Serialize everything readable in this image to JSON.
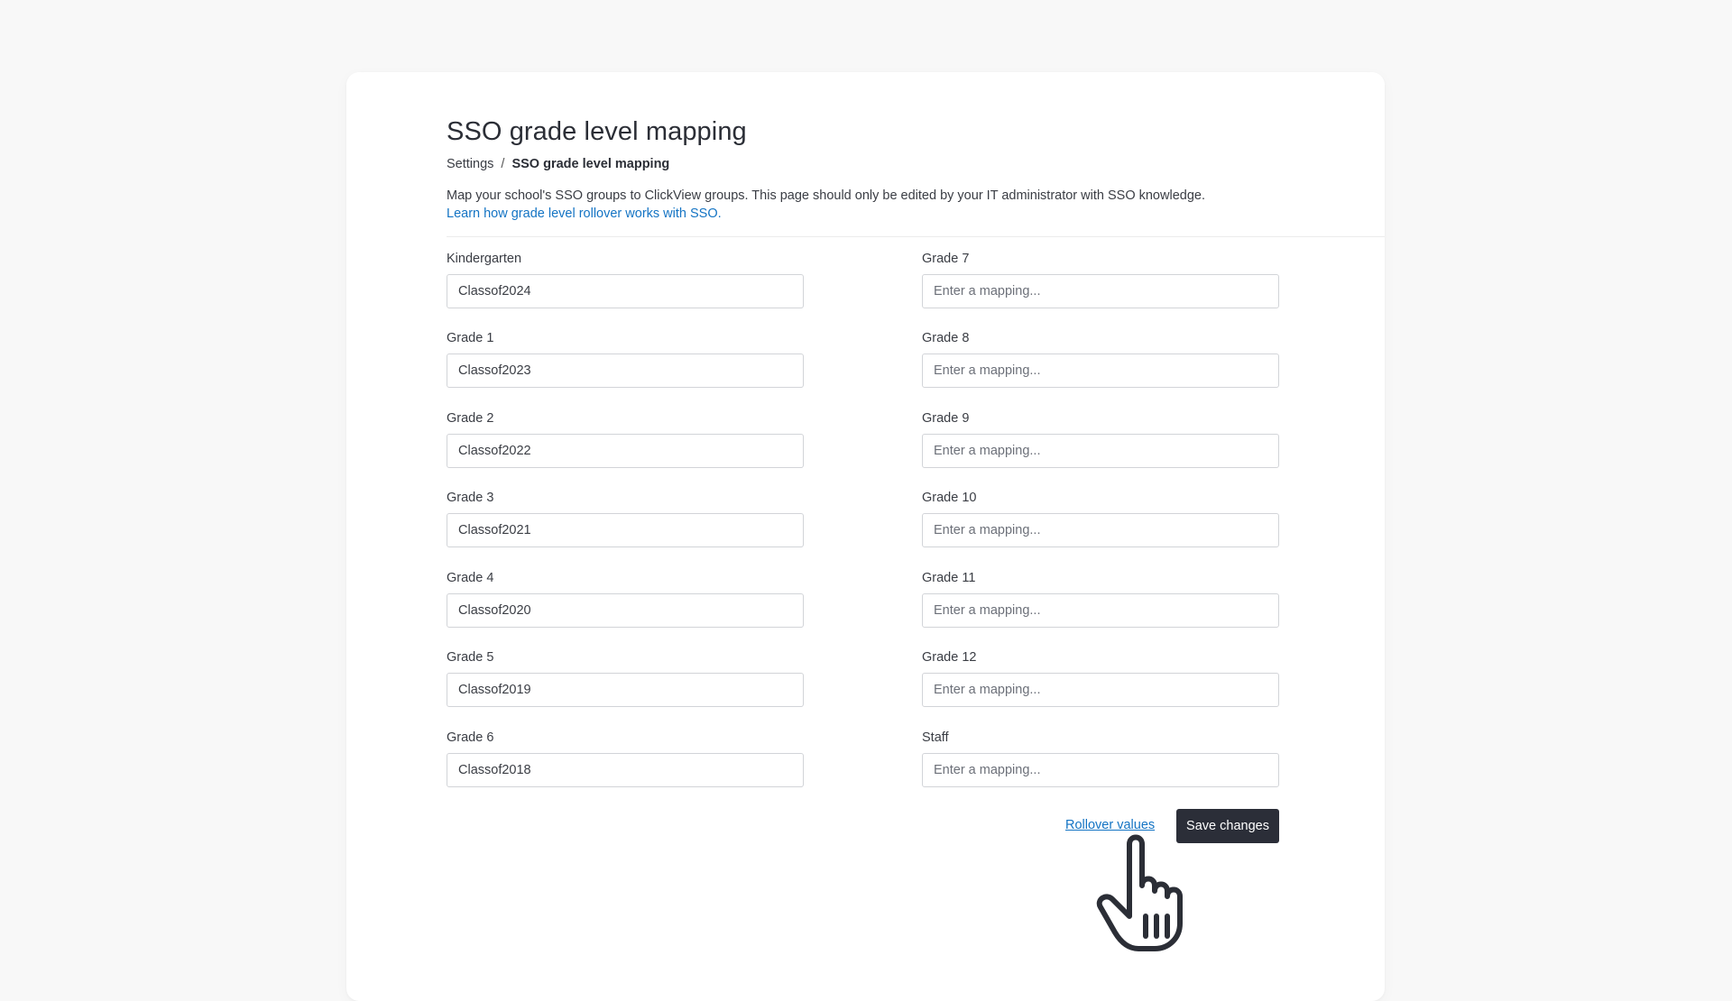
{
  "page": {
    "title": "SSO grade level mapping",
    "breadcrumb": {
      "parent": "Settings",
      "separator": "/",
      "current": "SSO grade level mapping"
    },
    "description": "Map your school's SSO groups to ClickView groups. This page should only be edited by your IT administrator with SSO knowledge.",
    "learn_link": "Learn how grade level rollover works with SSO."
  },
  "placeholder": "Enter a mapping...",
  "left_fields": [
    {
      "label": "Kindergarten",
      "value": "Classof2024"
    },
    {
      "label": "Grade 1",
      "value": "Classof2023"
    },
    {
      "label": "Grade 2",
      "value": "Classof2022"
    },
    {
      "label": "Grade 3",
      "value": "Classof2021"
    },
    {
      "label": "Grade 4",
      "value": "Classof2020"
    },
    {
      "label": "Grade 5",
      "value": "Classof2019"
    },
    {
      "label": "Grade 6",
      "value": "Classof2018"
    }
  ],
  "right_fields": [
    {
      "label": "Grade 7",
      "value": ""
    },
    {
      "label": "Grade 8",
      "value": ""
    },
    {
      "label": "Grade 9",
      "value": ""
    },
    {
      "label": "Grade 10",
      "value": ""
    },
    {
      "label": "Grade 11",
      "value": ""
    },
    {
      "label": "Grade 12",
      "value": ""
    },
    {
      "label": "Staff",
      "value": ""
    }
  ],
  "actions": {
    "rollover_label": "Rollover values",
    "save_label": "Save changes"
  },
  "colors": {
    "link": "#1474c4",
    "primary_button": "#2b2e38",
    "background": "#f8f8f8"
  },
  "icons": {
    "cursor": "hand-pointer-icon"
  }
}
